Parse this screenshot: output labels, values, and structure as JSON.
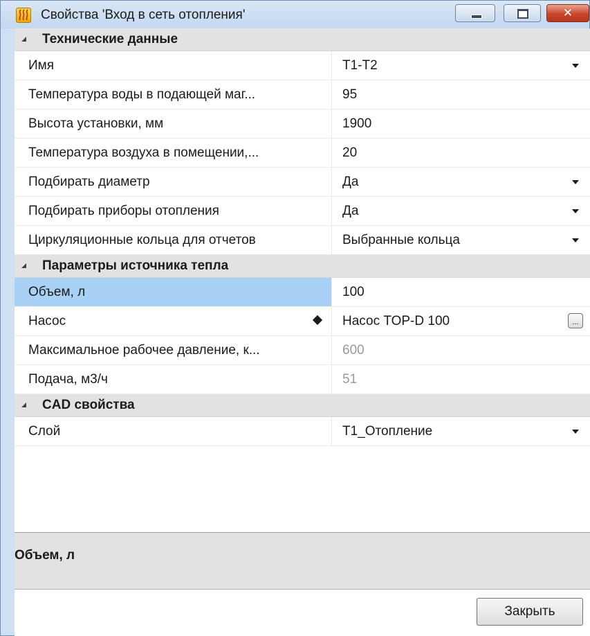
{
  "window": {
    "title": "Свойства 'Вход в сеть отопления'",
    "icon": "heating-icon",
    "buttons": {
      "minimize": "minimize-icon",
      "maximize": "maximize-icon",
      "close": "✕"
    }
  },
  "sections": [
    {
      "label": "Технические данные",
      "rows": [
        {
          "name": "Имя",
          "value": "Т1-Т2"
        },
        {
          "name": "Температура воды в подающей маг...",
          "value": "95"
        },
        {
          "name": "Высота установки, мм",
          "value": "1900"
        },
        {
          "name": "Температура воздуха в помещении,...",
          "value": "20"
        },
        {
          "name": "Подбирать диаметр",
          "value": "Да"
        },
        {
          "name": "Подбирать приборы отопления",
          "value": "Да"
        },
        {
          "name": "Циркуляционные кольца для отчетов",
          "value": "Выбранные кольца"
        }
      ]
    },
    {
      "label": "Параметры источника тепла",
      "rows": [
        {
          "name": "Объем, л",
          "value": "100"
        },
        {
          "name": "Насос",
          "value": "Насос TOP-D 100"
        },
        {
          "name": "Максимальное рабочее давление, к...",
          "value": "600"
        },
        {
          "name": "Подача, м3/ч",
          "value": "51"
        }
      ]
    },
    {
      "label": "CAD свойства",
      "rows": [
        {
          "name": "Слой",
          "value": "Т1_Отопление"
        }
      ]
    }
  ],
  "ellipsis_label": "...",
  "help": {
    "title": "Объем, л"
  },
  "close_button": "Закрыть",
  "colors": {
    "selected_row": "#a9d0f5",
    "section_bg": "#e2e2e2",
    "readonly_text": "#9a9a9a"
  }
}
